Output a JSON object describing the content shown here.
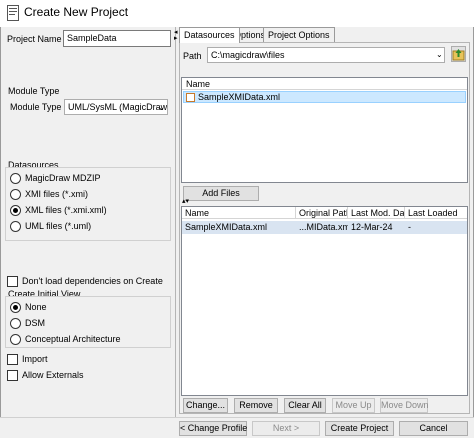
{
  "window": {
    "title": "Create New Project"
  },
  "left": {
    "project_name_label": "Project Name",
    "project_name_value": "SampleData",
    "module_type_group": "Module Type",
    "module_type_label": "Module Type",
    "module_type_value": "UML/SysML (MagicDraw",
    "datasources_group": "Datasources",
    "datasource_options": [
      {
        "label": "MagicDraw MDZIP",
        "selected": false
      },
      {
        "label": "XMI files (*.xmi)",
        "selected": false
      },
      {
        "label": "XML files (*.xmi.xml)",
        "selected": true
      },
      {
        "label": "UML files (*.uml)",
        "selected": false
      }
    ],
    "dont_load_deps": "Don't load dependencies on Create",
    "initial_view_group": "Create Initial View",
    "initial_view_options": [
      {
        "label": "None",
        "selected": true
      },
      {
        "label": "DSM",
        "selected": false
      },
      {
        "label": "Conceptual Architecture",
        "selected": false
      }
    ],
    "import_label": "Import",
    "allow_externals_label": "Allow Externals"
  },
  "tabs": [
    "Datasources",
    "Options",
    "Project Options"
  ],
  "path": {
    "label": "Path",
    "value": "C:\\magicdraw\\files"
  },
  "file_list": {
    "header": "Name",
    "items": [
      "SampleXMIData.xml"
    ]
  },
  "add_files_label": "Add Files",
  "selected_table": {
    "columns": [
      "Name",
      "Original Path",
      "Last Mod. Dat",
      "Last Loaded"
    ],
    "rows": [
      [
        "SampleXMIData.xml",
        "...MIData.xml",
        "12-Mar-24",
        "-"
      ]
    ]
  },
  "table_buttons": {
    "change": "Change...",
    "remove": "Remove",
    "clear_all": "Clear All",
    "move_up": "Move Up",
    "move_down": "Move Down"
  },
  "footer_buttons": {
    "back": "< Change Profile",
    "next": "Next >",
    "create": "Create Project",
    "cancel": "Cancel"
  },
  "colors": {
    "selection": "#cce8ff",
    "row_highlight": "#d9e4f1",
    "panel": "#f0f0f0"
  },
  "icons": {
    "title": "document-icon",
    "file": "xml-file-icon",
    "up_folder": "up-folder-icon"
  }
}
